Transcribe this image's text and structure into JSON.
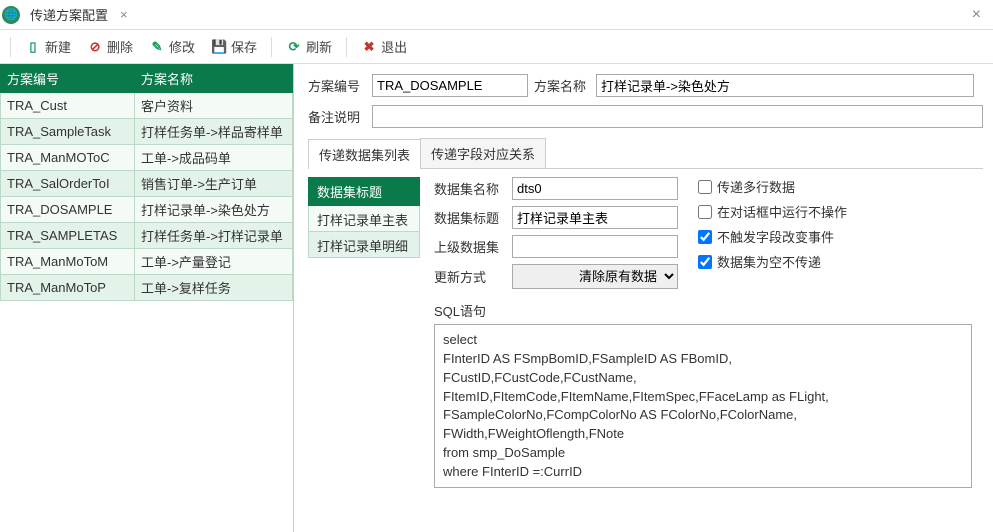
{
  "window": {
    "title": "传递方案配置"
  },
  "toolbar": {
    "new": "新建",
    "delete": "删除",
    "edit": "修改",
    "save": "保存",
    "refresh": "刷新",
    "exit": "退出"
  },
  "grid": {
    "col_code": "方案编号",
    "col_name": "方案名称",
    "rows": [
      {
        "code": "TRA_Cust",
        "name": "客户资料"
      },
      {
        "code": "TRA_SampleTask",
        "name": "打样任务单->样品寄样单"
      },
      {
        "code": "TRA_ManMOToC",
        "name": "工单->成品码单"
      },
      {
        "code": "TRA_SalOrderToI",
        "name": "销售订单->生产订单"
      },
      {
        "code": "TRA_DOSAMPLE",
        "name": "打样记录单->染色处方"
      },
      {
        "code": "TRA_SAMPLETAS",
        "name": "打样任务单->打样记录单"
      },
      {
        "code": "TRA_ManMoToM",
        "name": "工单->产量登记"
      },
      {
        "code": "TRA_ManMoToP",
        "name": "工单->复样任务"
      }
    ]
  },
  "form": {
    "code_label": "方案编号",
    "code_value": "TRA_DOSAMPLE",
    "name_label": "方案名称",
    "name_value": "打样记录单->染色处方",
    "remark_label": "备注说明",
    "remark_value": ""
  },
  "subtabs": {
    "tab1": "传递数据集列表",
    "tab2": "传递字段对应关系"
  },
  "dslist": {
    "header": "数据集标题",
    "items": [
      "打样记录单主表",
      "打样记录单明细"
    ]
  },
  "dsdetail": {
    "name_label": "数据集名称",
    "name_value": "dts0",
    "title_label": "数据集标题",
    "title_value": "打样记录单主表",
    "parent_label": "上级数据集",
    "parent_value": "",
    "update_label": "更新方式",
    "update_value": "清除原有数据",
    "sql_label": "SQL语句",
    "sql_value": "select\nFInterID AS FSmpBomID,FSampleID AS FBomID,\nFCustID,FCustCode,FCustName,\nFItemID,FItemCode,FItemName,FItemSpec,FFaceLamp as FLight,\nFSampleColorNo,FCompColorNo AS FColorNo,FColorName,\nFWidth,FWeightOflength,FNote\nfrom smp_DoSample\nwhere FInterID =:CurrID"
  },
  "checks": {
    "multi": "传递多行数据",
    "dialog": "在对话框中运行不操作",
    "nochange": "不触发字段改变事件",
    "empty": "数据集为空不传递"
  }
}
